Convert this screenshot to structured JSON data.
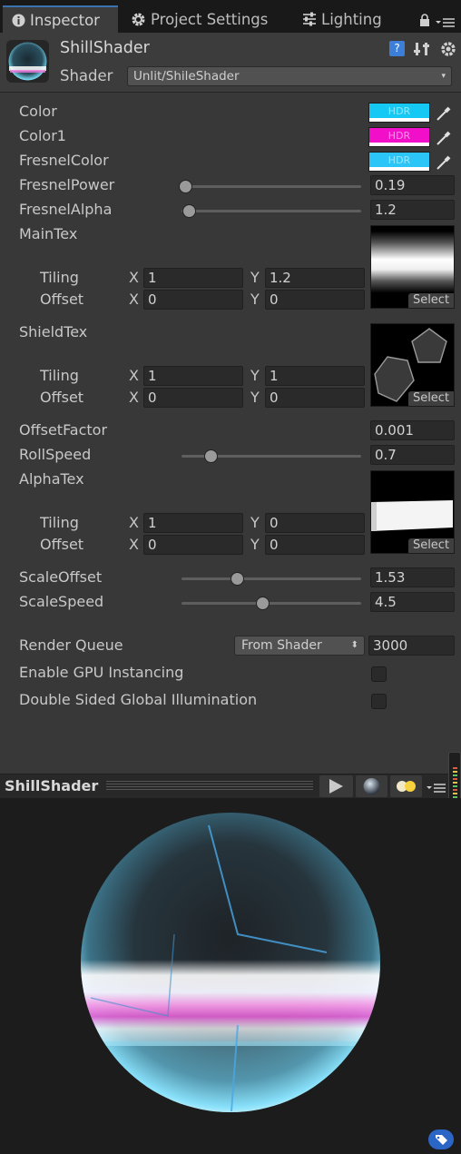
{
  "tabs": [
    {
      "label": "Inspector",
      "icon": "info-icon"
    },
    {
      "label": "Project Settings",
      "icon": "gear-icon"
    },
    {
      "label": "Lighting",
      "icon": "sliders-icon"
    }
  ],
  "material": {
    "name": "ShillShader",
    "shader_label": "Shader",
    "shader_value": "Unlit/ShileShader"
  },
  "colors": {
    "accent": "#3a72b0",
    "cyan_swatch": "#16c8f4",
    "magenta_swatch": "#f20fc9",
    "fresnel_swatch": "#2cc5f7"
  },
  "properties": {
    "color": {
      "label": "Color",
      "hdr": "HDR"
    },
    "color1": {
      "label": "Color1",
      "hdr": "HDR"
    },
    "fresnel_color": {
      "label": "FresnelColor",
      "hdr": "HDR"
    },
    "fresnel_power": {
      "label": "FresnelPower",
      "value": "0.19",
      "fraction": 0.02
    },
    "fresnel_alpha": {
      "label": "FresnelAlpha",
      "value": "1.2",
      "fraction": 0.04
    },
    "main_tex": {
      "label": "MainTex",
      "select": "Select",
      "tiling_label": "Tiling",
      "offset_label": "Offset",
      "x_label": "X",
      "y_label": "Y",
      "tiling_x": "1",
      "tiling_y": "1.2",
      "offset_x": "0",
      "offset_y": "0"
    },
    "shield_tex": {
      "label": "ShieldTex",
      "select": "Select",
      "tiling_label": "Tiling",
      "offset_label": "Offset",
      "x_label": "X",
      "y_label": "Y",
      "tiling_x": "1",
      "tiling_y": "1",
      "offset_x": "0",
      "offset_y": "0"
    },
    "offset_factor": {
      "label": "OffsetFactor",
      "value": "0.001"
    },
    "roll_speed": {
      "label": "RollSpeed",
      "value": "0.7",
      "fraction": 0.16
    },
    "alpha_tex": {
      "label": "AlphaTex",
      "select": "Select",
      "tiling_label": "Tiling",
      "offset_label": "Offset",
      "x_label": "X",
      "y_label": "Y",
      "tiling_x": "1",
      "tiling_y": "0",
      "offset_x": "0",
      "offset_y": "0"
    },
    "scale_offset": {
      "label": "ScaleOffset",
      "value": "1.53",
      "fraction": 0.31
    },
    "scale_speed": {
      "label": "ScaleSpeed",
      "value": "4.5",
      "fraction": 0.45
    }
  },
  "render_queue": {
    "label": "Render Queue",
    "dropdown": "From Shader",
    "value": "3000"
  },
  "gpu_instancing": {
    "label": "Enable GPU Instancing",
    "checked": false
  },
  "double_sided_gi": {
    "label": "Double Sided Global Illumination",
    "checked": false
  },
  "preview": {
    "title": "ShillShader"
  }
}
